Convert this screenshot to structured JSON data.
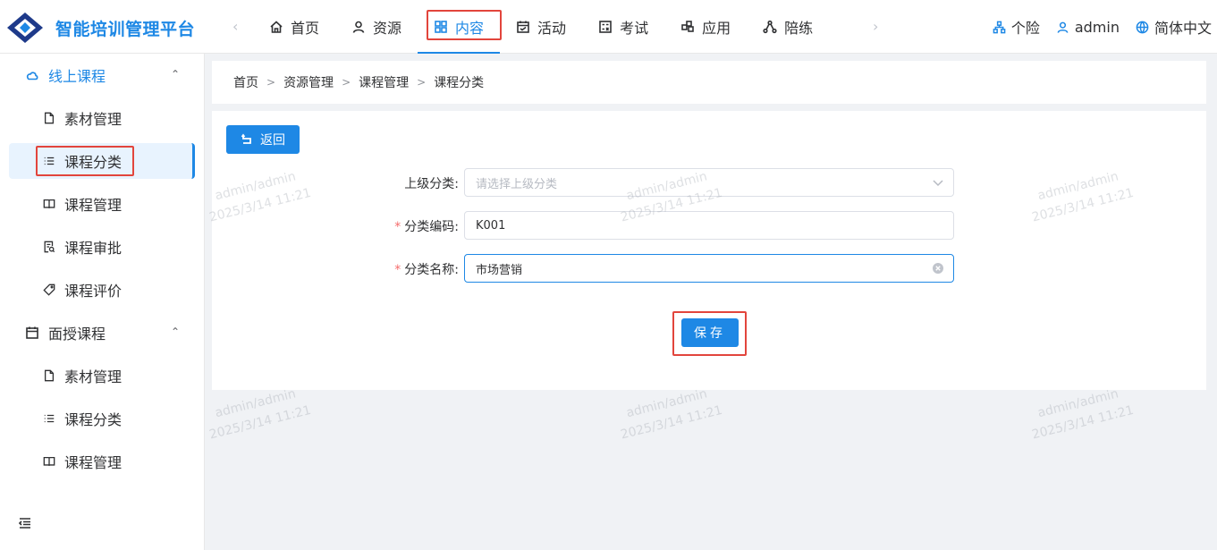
{
  "app": {
    "title": "智能培训管理平台"
  },
  "nav": {
    "items": [
      {
        "label": "首页",
        "icon": "home-icon"
      },
      {
        "label": "资源",
        "icon": "user-icon"
      },
      {
        "label": "内容",
        "icon": "grid-icon",
        "active": true
      },
      {
        "label": "活动",
        "icon": "calendar-icon"
      },
      {
        "label": "考试",
        "icon": "exam-icon"
      },
      {
        "label": "应用",
        "icon": "app-icon"
      },
      {
        "label": "陪练",
        "icon": "nodes-icon"
      }
    ]
  },
  "header_right": {
    "company": "个险",
    "user": "admin",
    "language": "简体中文"
  },
  "sidebar": {
    "groups": [
      {
        "label": "线上课程",
        "icon": "cloud-icon",
        "expanded": true,
        "items": [
          {
            "label": "素材管理",
            "icon": "file-icon"
          },
          {
            "label": "课程分类",
            "icon": "list-icon",
            "active": true
          },
          {
            "label": "课程管理",
            "icon": "book-icon"
          },
          {
            "label": "课程审批",
            "icon": "approve-icon"
          },
          {
            "label": "课程评价",
            "icon": "tag-icon"
          }
        ]
      },
      {
        "label": "面授课程",
        "icon": "calendar-icon",
        "expanded": true,
        "items": [
          {
            "label": "素材管理",
            "icon": "file-icon"
          },
          {
            "label": "课程分类",
            "icon": "list-icon"
          },
          {
            "label": "课程管理",
            "icon": "book-icon"
          }
        ]
      }
    ]
  },
  "breadcrumb": [
    "首页",
    "资源管理",
    "课程管理",
    "课程分类"
  ],
  "form": {
    "back_label": "返回",
    "parent": {
      "label": "上级分类:",
      "placeholder": "请选择上级分类",
      "value": ""
    },
    "code": {
      "label": "分类编码:",
      "value": "K001",
      "required": true
    },
    "name": {
      "label": "分类名称:",
      "value": "市场营销",
      "required": true
    },
    "save_label": "保存"
  },
  "watermark": {
    "line1": "admin/admin",
    "line2": "2025/3/14 11:21"
  },
  "colors": {
    "accent": "#1e88e5",
    "highlight": "#e2453c",
    "required": "#f56c6c"
  }
}
